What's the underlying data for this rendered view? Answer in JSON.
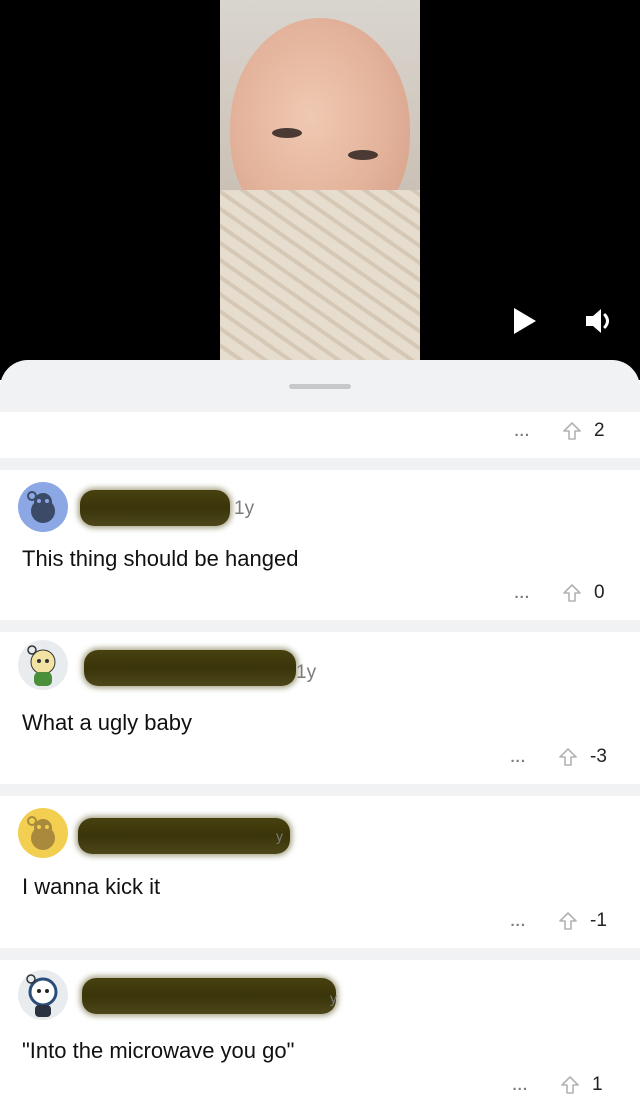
{
  "video": {
    "play_icon": "play-icon",
    "volume_icon": "volume-icon"
  },
  "post_actions": {
    "more": "...",
    "score": "2"
  },
  "comments": [
    {
      "age": "1y",
      "text": "This thing should be hanged",
      "more": "...",
      "score": "0",
      "avatar_color": "#8ba7e4"
    },
    {
      "age": "1y",
      "text": "What a ugly baby",
      "more": "...",
      "score": "-3",
      "avatar_color": "#e9ecef"
    },
    {
      "age": "y",
      "text": "I wanna kick it",
      "more": "...",
      "score": "-1",
      "avatar_color": "#f2cf50"
    },
    {
      "age": "y",
      "text": "\"Into the microwave you go\"",
      "more": "...",
      "score": "1",
      "avatar_color": "#e9ecef"
    }
  ],
  "colors": {
    "sheet_bg": "#f1f2f4",
    "redaction": "#3f390c",
    "text": "#111111",
    "meta": "#7c7c7c"
  }
}
